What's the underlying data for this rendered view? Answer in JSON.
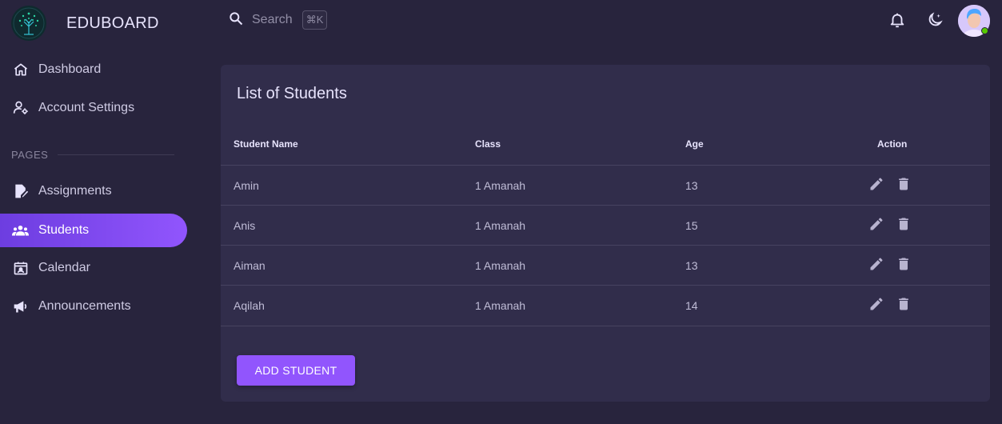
{
  "brand": {
    "name": "EDUBOARD"
  },
  "sidebar": {
    "top_items": [
      {
        "label": "Dashboard",
        "icon": "home-icon"
      },
      {
        "label": "Account Settings",
        "icon": "account-cog-icon"
      }
    ],
    "section_label": "PAGES",
    "page_items": [
      {
        "label": "Assignments",
        "icon": "file-edit-icon"
      },
      {
        "label": "Students",
        "icon": "users-icon",
        "active": true
      },
      {
        "label": "Calendar",
        "icon": "calendar-icon"
      },
      {
        "label": "Announcements",
        "icon": "megaphone-icon"
      }
    ]
  },
  "topbar": {
    "search_label": "Search",
    "search_shortcut": "⌘K",
    "icons": [
      "bell-icon",
      "moon-icon",
      "avatar"
    ]
  },
  "card": {
    "title": "List of Students",
    "columns": [
      "Student Name",
      "Class",
      "Age",
      "Action"
    ],
    "rows": [
      {
        "name": "Amin",
        "class": "1 Amanah",
        "age": "13"
      },
      {
        "name": "Anis",
        "class": "1 Amanah",
        "age": "15"
      },
      {
        "name": "Aiman",
        "class": "1 Amanah",
        "age": "13"
      },
      {
        "name": "Aqilah",
        "class": "1 Amanah",
        "age": "14"
      }
    ],
    "add_button": "ADD STUDENT"
  },
  "colors": {
    "background": "#28243d",
    "card": "#312d4b",
    "accent": "#9155fd",
    "text": "#e7e3fc",
    "online": "#56ca00"
  }
}
